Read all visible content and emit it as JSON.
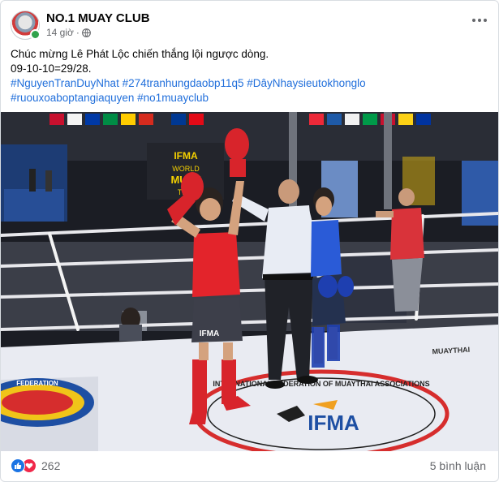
{
  "post": {
    "page_name": "NO.1 MUAY CLUB",
    "time": "14 giờ",
    "separator": "·",
    "caption_line1": "Chúc mừng Lê Phát Lộc chiến thắng lội ngược dòng.",
    "caption_line2": "09-10-10=29/28.",
    "hashtags": [
      "#NguyenTranDuyNhat",
      "#274tranhungdaobp11q5",
      "#DâyNhaysieutokhonglo",
      "#ruouxoaboptangiaquyen",
      "#no1muayclub"
    ]
  },
  "photo": {
    "banner_ifma": "IFMA",
    "banner_world": "WORLD",
    "banner_muay": "MUAY",
    "banner_thai": "THAI",
    "mat_ifma": "IFMA",
    "mat_ring_text": "INTERNATIONAL FEDERATION OF MUAYTHAI ASSOCIATIONS",
    "mat_federation": "FEDERATION",
    "mat_side": "MUAYTHAI",
    "shorts_text": "IFMA"
  },
  "footer": {
    "reaction_count": "262",
    "comments": "5 bình luận"
  },
  "colors": {
    "hashtag": "#216fdb",
    "like": "#1b74e4",
    "love": "#f0284a",
    "online": "#31a24c"
  },
  "icons": [
    "globe-icon",
    "more-icon",
    "like-icon",
    "love-icon"
  ]
}
